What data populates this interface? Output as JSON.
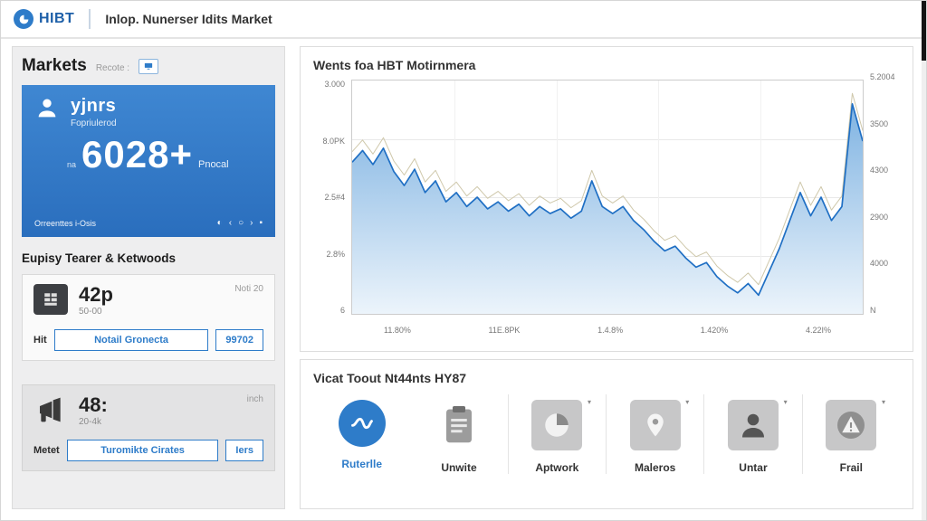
{
  "header": {
    "logo": "HIBT",
    "title": "Inlop. Nunerser Idits Market"
  },
  "icons": {
    "caret": "▾",
    "half": "◐",
    "chev_left": "‹",
    "dot": "○",
    "chev_right": "›",
    "bars": "▪"
  },
  "colors": {
    "accent": "#2e7cc9",
    "card_gradient_top": "#3f87d2",
    "card_gradient_bottom": "#2a6ebd"
  },
  "sidebar": {
    "title": "Markets",
    "subtitle": "Recote :",
    "stat_card": {
      "name": "yjnrs",
      "subtitle": "Fopriulerod",
      "prefix": "na",
      "value": "6028+",
      "suffix": "Pnocal",
      "footer": "Orreenttes i-Osis"
    },
    "section_title": "Eupisy Tearer & Ketwoods",
    "cards": [
      {
        "value": "42p",
        "sub": "50-00",
        "note": "Noti 20",
        "label": "Hit",
        "btn1": "Notail Gronecta",
        "btn2": "99702"
      },
      {
        "value": "48:",
        "sub": "20-4k",
        "note": "inch",
        "label": "Metet",
        "btn1": "Turomikte Cirates",
        "btn2": "Iers"
      }
    ]
  },
  "chart_panel": {
    "title": "Wents foa HBT Motirnmera",
    "chart_data": {
      "type": "area",
      "title": "Wents foa HBT Motirnmera",
      "series": [
        {
          "name": "HBT Motirnmera",
          "values": [
            0.65,
            0.7,
            0.64,
            0.71,
            0.61,
            0.55,
            0.62,
            0.52,
            0.57,
            0.48,
            0.52,
            0.46,
            0.5,
            0.45,
            0.48,
            0.44,
            0.47,
            0.42,
            0.46,
            0.43,
            0.45,
            0.41,
            0.44,
            0.57,
            0.46,
            0.43,
            0.46,
            0.4,
            0.36,
            0.31,
            0.27,
            0.29,
            0.24,
            0.2,
            0.22,
            0.16,
            0.12,
            0.09,
            0.13,
            0.08,
            0.18,
            0.28,
            0.4,
            0.52,
            0.42,
            0.5,
            0.4,
            0.46,
            0.9,
            0.74
          ]
        }
      ],
      "x_ticks": [
        "11.80%",
        "11E.8PK",
        "1.4.8%",
        "1.420%",
        "4.22I%"
      ],
      "y_ticks_left": [
        "3.000",
        "8.0PK",
        "2.5#4",
        "2.8%",
        "6"
      ],
      "y_ticks_right": [
        "5.2004",
        "3500",
        "4300",
        "2900",
        "4000",
        "N"
      ],
      "grid": true,
      "legend": "none",
      "line_color": "#1f6fc4",
      "outline_color": "#cfc8ab",
      "fill_top": "#7fb3e2",
      "fill_bottom": "#ecf4fb"
    }
  },
  "actions_panel": {
    "title": "Vicat Toout Nt44nts HY87",
    "items": [
      {
        "label": "Ruterlle",
        "icon": "wave-icon"
      },
      {
        "label": "Unwite",
        "icon": "clipboard-icon"
      },
      {
        "label": "Aptwork",
        "icon": "pie-icon"
      },
      {
        "label": "Maleros",
        "icon": "pin-icon"
      },
      {
        "label": "Untar",
        "icon": "person-icon"
      },
      {
        "label": "Frail",
        "icon": "alert-icon"
      }
    ]
  }
}
